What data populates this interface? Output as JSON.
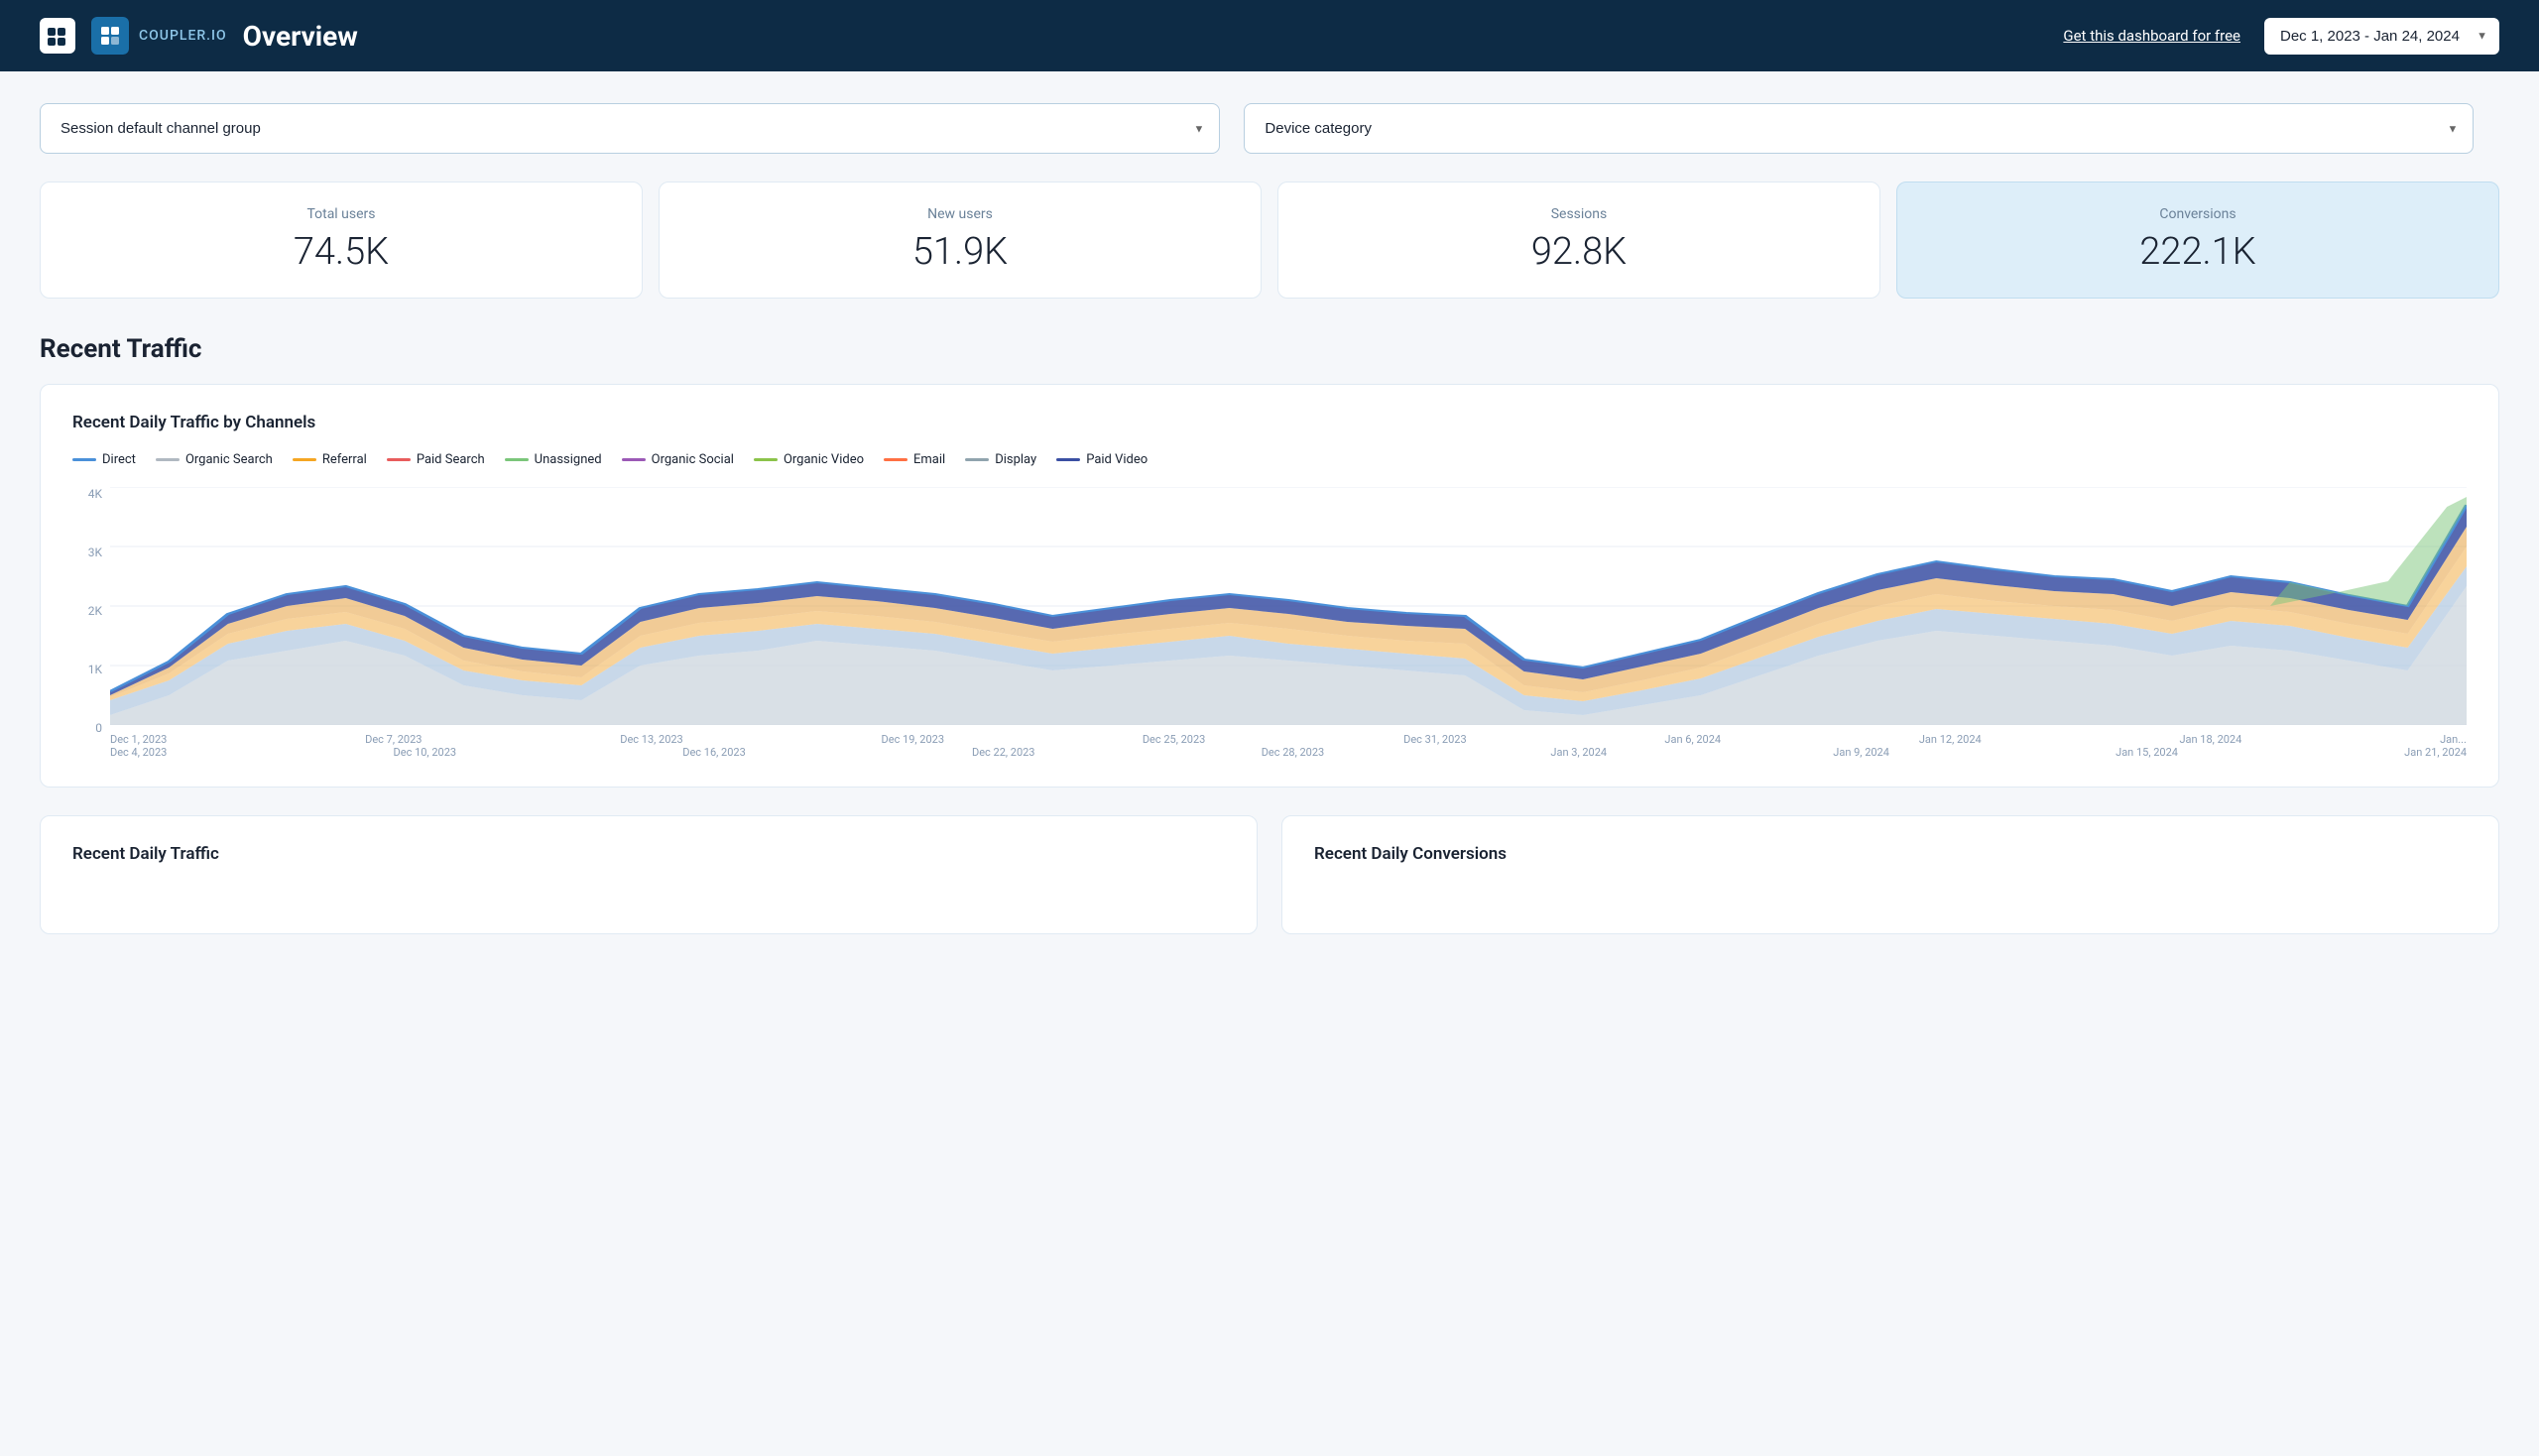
{
  "header": {
    "logo_text": "C",
    "title": "Overview",
    "get_dashboard_label": "Get this dashboard for free",
    "date_range_value": "Dec 1, 2023 - Jan 24, 2024"
  },
  "filters": {
    "channel_group_label": "Session default channel group",
    "device_category_label": "Device category"
  },
  "metrics": [
    {
      "label": "Total users",
      "value": "74.5K"
    },
    {
      "label": "New users",
      "value": "51.9K"
    },
    {
      "label": "Sessions",
      "value": "92.8K"
    },
    {
      "label": "Conversions",
      "value": "222.1K"
    }
  ],
  "recent_traffic": {
    "section_title": "Recent Traffic",
    "chart_title": "Recent Daily Traffic by Channels",
    "legend": [
      {
        "label": "Direct",
        "color": "#4a90d9"
      },
      {
        "label": "Organic Search",
        "color": "#b0b8c1"
      },
      {
        "label": "Referral",
        "color": "#f5a623"
      },
      {
        "label": "Paid Search",
        "color": "#e85c5c"
      },
      {
        "label": "Unassigned",
        "color": "#7bc67a"
      },
      {
        "label": "Organic Social",
        "color": "#9b59b6"
      },
      {
        "label": "Organic Video",
        "color": "#8bc34a"
      },
      {
        "label": "Email",
        "color": "#ff7043"
      },
      {
        "label": "Display",
        "color": "#90a4ae"
      },
      {
        "label": "Paid Video",
        "color": "#3a4fa3"
      }
    ],
    "y_axis_labels": [
      "4K",
      "3K",
      "2K",
      "1K",
      "0"
    ],
    "x_axis_labels_row1": [
      "Dec 1, 2023",
      "Dec 7, 2023",
      "Dec 13, 2023",
      "Dec 19, 2023",
      "Dec 25, 2023",
      "Dec 31, 2023",
      "Jan 6, 2024",
      "Jan 12, 2024",
      "Jan 18, 2024",
      "Jan..."
    ],
    "x_axis_labels_row2": [
      "Dec 4, 2023",
      "Dec 10, 2023",
      "Dec 16, 2023",
      "Dec 22, 2023",
      "Dec 28, 2023",
      "Jan 3, 2024",
      "Jan 9, 2024",
      "Jan 15, 2024",
      "Jan 21, 2024"
    ]
  },
  "bottom": {
    "daily_traffic_title": "Recent Daily Traffic",
    "daily_conversions_title": "Recent Daily Conversions"
  },
  "colors": {
    "header_bg": "#0d2b45",
    "accent_blue": "#4a90d9",
    "card_highlight_bg": "#ddeef9"
  }
}
